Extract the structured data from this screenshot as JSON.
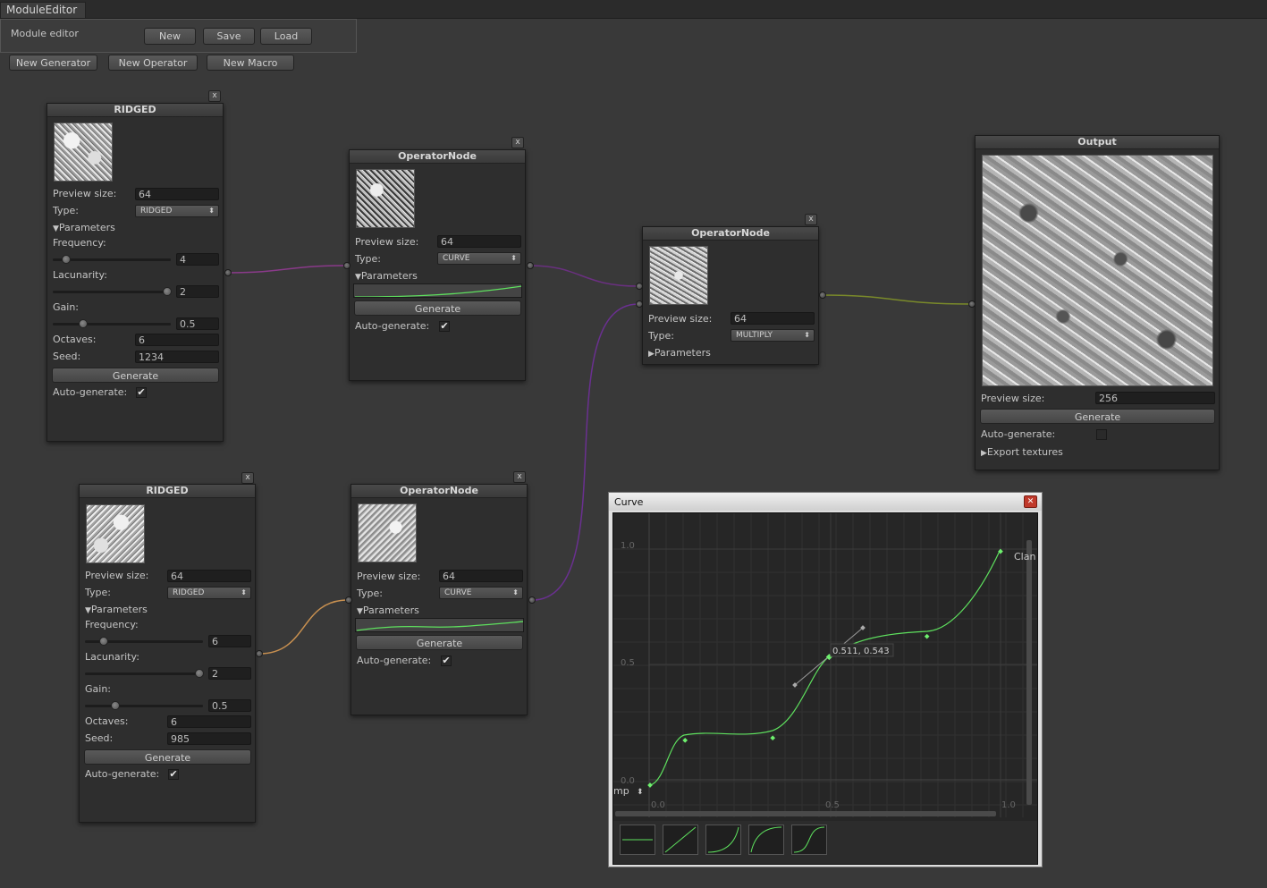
{
  "window": {
    "tab_title": "ModuleEditor"
  },
  "toolbar": {
    "panel_label": "Module editor",
    "new_label": "New",
    "save_label": "Save",
    "load_label": "Load",
    "new_generator_label": "New Generator",
    "new_operator_label": "New Operator",
    "new_macro_label": "New Macro"
  },
  "common": {
    "close": "x",
    "preview_size_label": "Preview size:",
    "type_label": "Type:",
    "parameters_label": "Parameters",
    "frequency_label": "Frequency:",
    "lacunarity_label": "Lacunarity:",
    "gain_label": "Gain:",
    "octaves_label": "Octaves:",
    "seed_label": "Seed:",
    "generate_label": "Generate",
    "auto_generate_label": "Auto-generate:",
    "check_mark": "✔",
    "expanded_arrow": "▼",
    "collapsed_arrow": "▶",
    "select_arrow": "⬍"
  },
  "ridged1": {
    "title": "RIDGED",
    "preview_size": "64",
    "type": "RIDGED",
    "frequency": "4",
    "lacunarity": "2",
    "gain": "0.5",
    "octaves": "6",
    "seed": "1234",
    "auto_generate": true
  },
  "ridged2": {
    "title": "RIDGED",
    "preview_size": "64",
    "type": "RIDGED",
    "frequency": "6",
    "lacunarity": "2",
    "gain": "0.5",
    "octaves": "6",
    "seed": "985",
    "auto_generate": true
  },
  "operator1": {
    "title": "OperatorNode",
    "preview_size": "64",
    "type": "CURVE",
    "auto_generate": true
  },
  "operator2": {
    "title": "OperatorNode",
    "preview_size": "64",
    "type": "CURVE",
    "auto_generate": true
  },
  "operator3": {
    "title": "OperatorNode",
    "preview_size": "64",
    "type": "MULTIPLY"
  },
  "output": {
    "title": "Output",
    "preview_size": "256",
    "generate_label": "Generate",
    "auto_generate_label": "Auto-generate:",
    "auto_generate": false,
    "export_label": "Export textures"
  },
  "curve_window": {
    "title": "Curve",
    "close_icon": "✕",
    "y_ticks": [
      "1.0",
      "0.5",
      "0.0"
    ],
    "x_ticks": [
      "0.0",
      "0.5",
      "1.0"
    ],
    "tooltip": "0.511, 0.543",
    "clamp_partial_right": "Clan",
    "wrap_partial_left": "mp",
    "keys": [
      [
        0.0,
        0.0
      ],
      [
        0.1,
        0.19
      ],
      [
        0.35,
        0.2
      ],
      [
        0.511,
        0.543
      ],
      [
        0.79,
        0.63
      ],
      [
        1.0,
        0.99
      ]
    ]
  },
  "colors": {
    "background": "#393939",
    "node_body": "#2e2e2e",
    "curve_green": "#5ee05e",
    "wire_purple": "#8a3a8a",
    "wire_orange": "#c89050",
    "wire_olive": "#7a8a2a"
  }
}
